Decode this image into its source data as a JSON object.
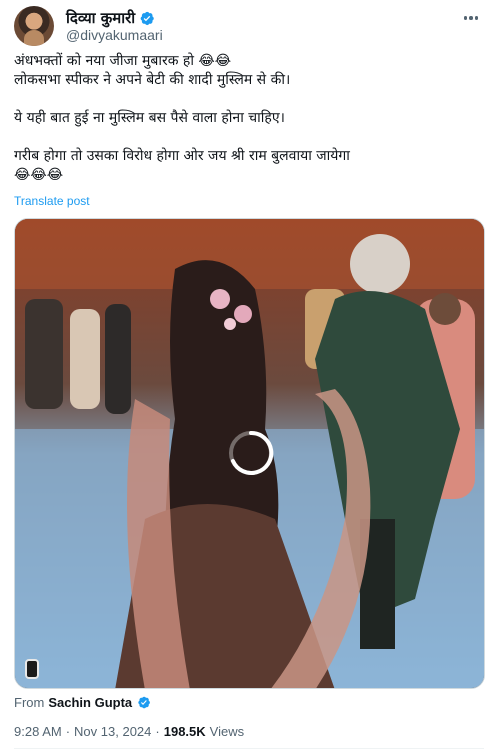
{
  "author": {
    "display_name": "दिव्या कुमारी",
    "handle": "@divyakumaari",
    "avatar_icon": "avatar-photo",
    "verified_icon": "verified-badge-icon"
  },
  "tweet": {
    "lines": [
      "अंधभक्तों को नया जीजा मुबारक हो 😂😂",
      "लोकसभा स्पीकर ने अपने बेटी की शादी मुस्लिम से की।",
      "",
      "ये यही बात हुई ना मुस्लिम बस पैसे वाला होना चाहिए।",
      "",
      "गरीब होगा तो उसका विरोध होगा ओर जय श्री राम बुलवाया जायेगा",
      "😂😂😂"
    ],
    "translate_label": "Translate post"
  },
  "media": {
    "type": "video",
    "loading": true,
    "from_label": "From",
    "from_name": "Sachin Gupta"
  },
  "meta": {
    "time": "9:28 AM",
    "separator": "·",
    "date": "Nov 13, 2024",
    "views_count": "198.5K",
    "views_label": "Views"
  },
  "colors": {
    "accent": "#1d9bf0",
    "text_primary": "#0f1419",
    "text_secondary": "#536471"
  }
}
